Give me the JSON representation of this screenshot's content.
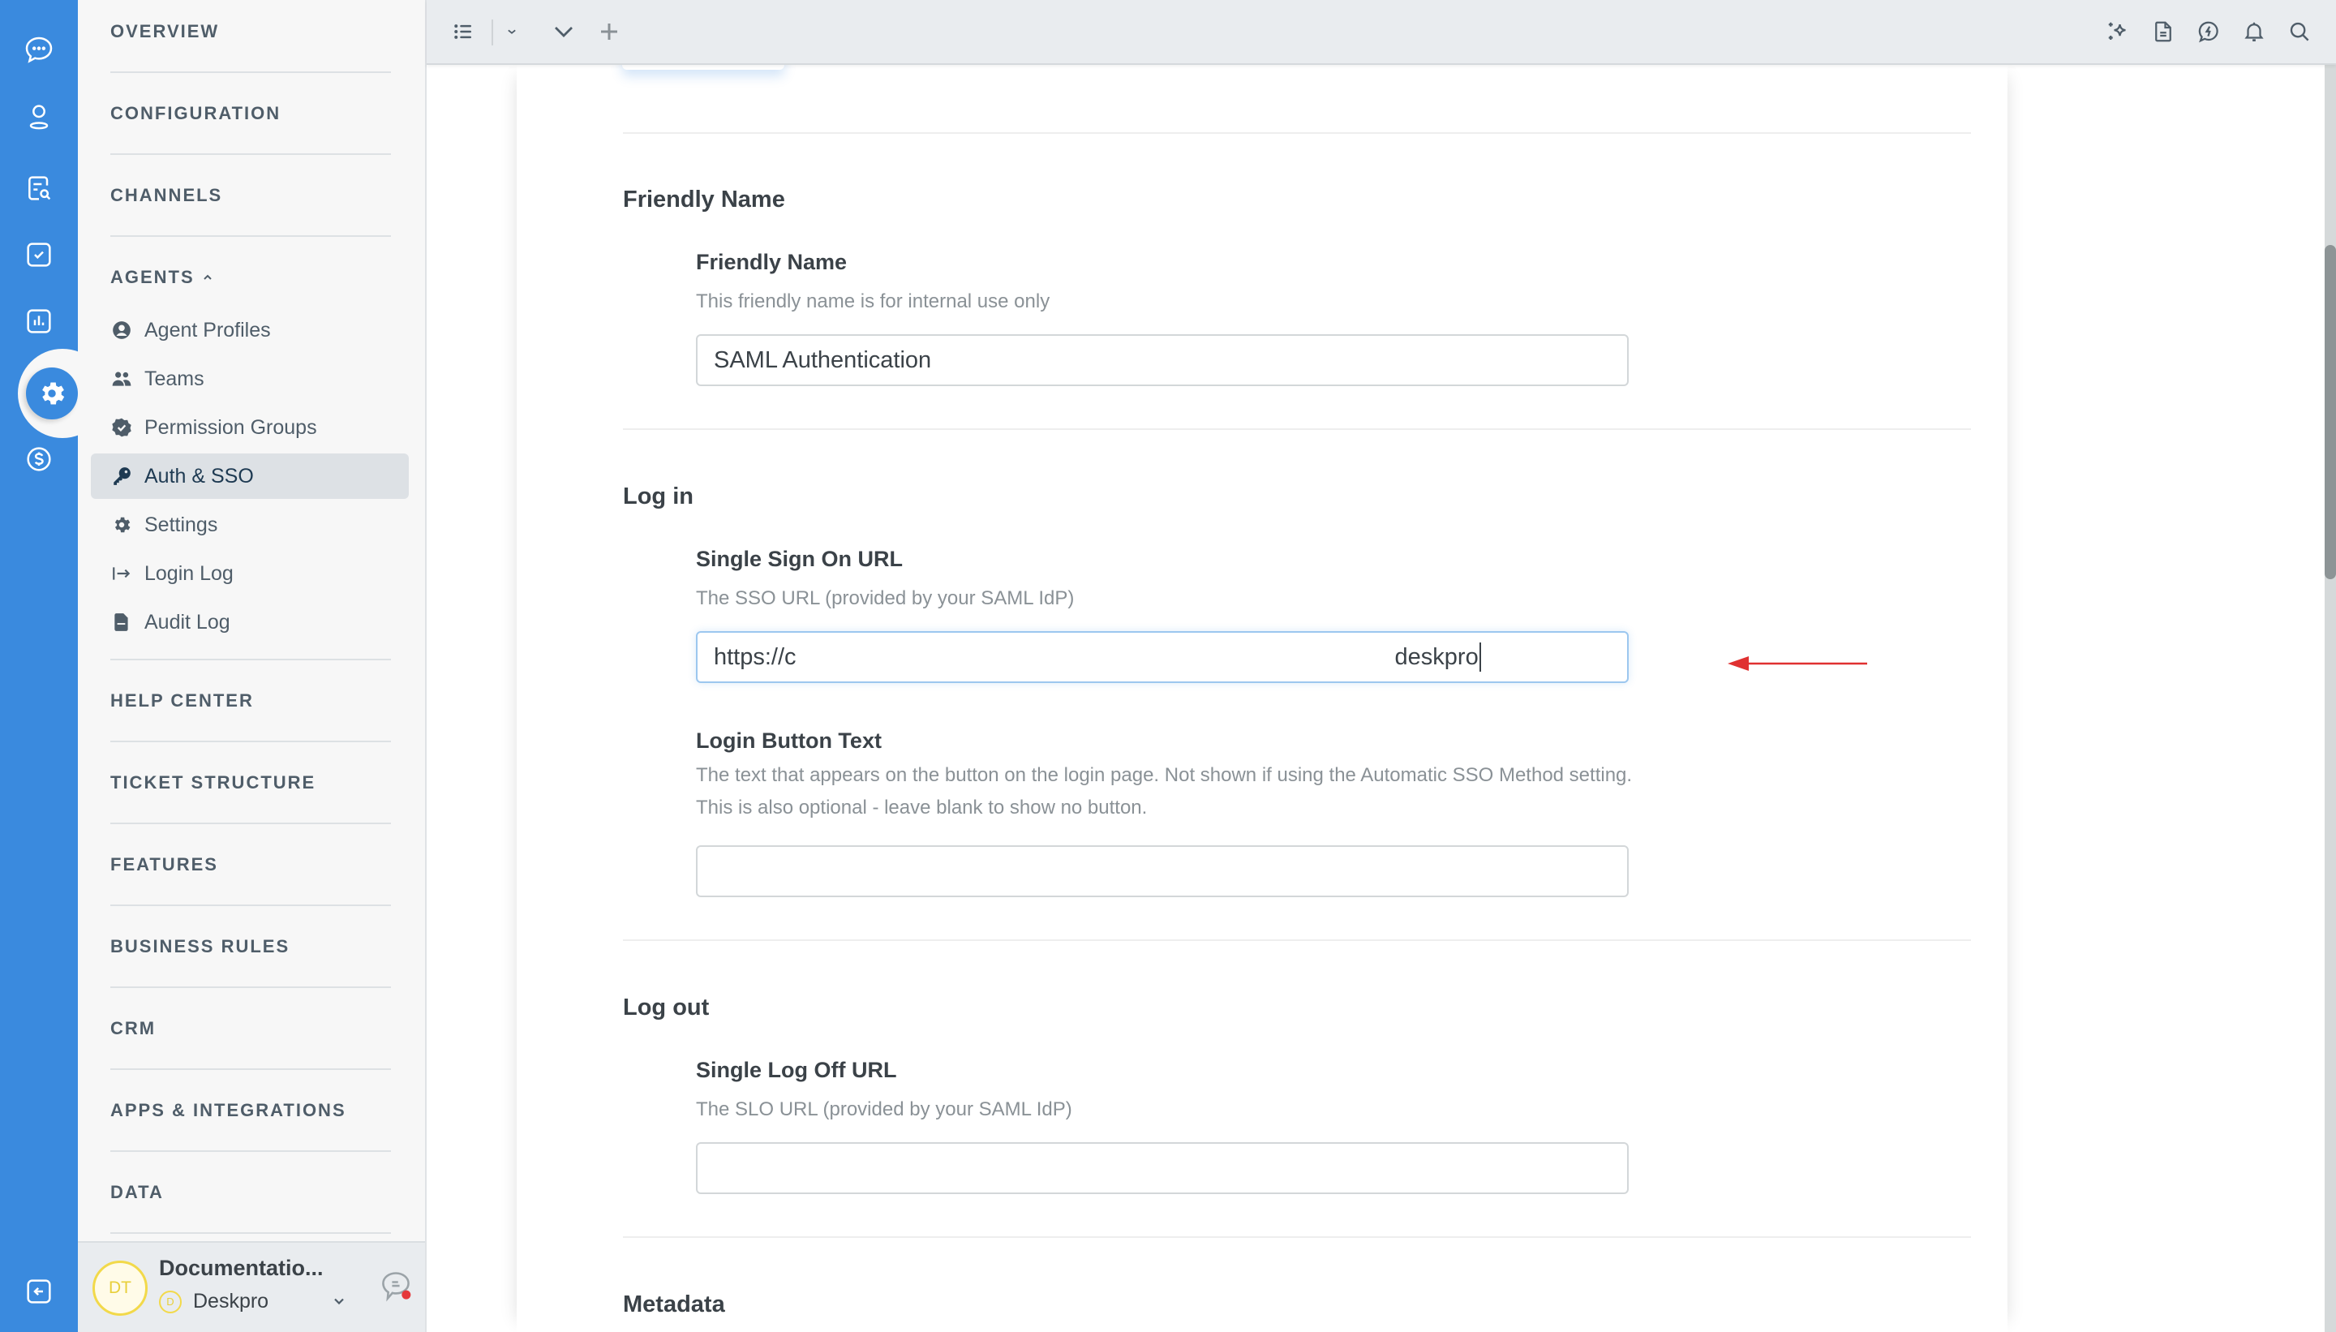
{
  "rail": {
    "icons": [
      "chat-icon",
      "user-icon",
      "search-document-icon",
      "task-check-icon",
      "reports-chart-icon",
      "settings-gear-icon",
      "billing-dollar-icon",
      "back-arrow-icon"
    ],
    "active": "settings-gear-icon",
    "accent_color": "#3a8ade"
  },
  "nav": {
    "sections": [
      {
        "label": "OVERVIEW"
      },
      {
        "label": "CONFIGURATION"
      },
      {
        "label": "CHANNELS"
      },
      {
        "label": "AGENTS",
        "expanded": true,
        "items": [
          {
            "label": "Agent Profiles",
            "icon": "user-circle-icon"
          },
          {
            "label": "Teams",
            "icon": "users-icon"
          },
          {
            "label": "Permission Groups",
            "icon": "badge-check-icon"
          },
          {
            "label": "Auth & SSO",
            "icon": "key-icon",
            "selected": true
          },
          {
            "label": "Settings",
            "icon": "gear-icon"
          },
          {
            "label": "Login Log",
            "icon": "login-arrow-icon"
          },
          {
            "label": "Audit Log",
            "icon": "file-icon"
          }
        ]
      },
      {
        "label": "HELP CENTER"
      },
      {
        "label": "TICKET STRUCTURE"
      },
      {
        "label": "FEATURES"
      },
      {
        "label": "BUSINESS RULES"
      },
      {
        "label": "CRM"
      },
      {
        "label": "APPS & INTEGRATIONS"
      },
      {
        "label": "DATA"
      }
    ],
    "footer": {
      "avatar_initials": "DT",
      "name": "Documentatio...",
      "org_badge": "D",
      "org": "Deskpro"
    }
  },
  "topbar": {
    "left_icons": [
      "list-icon",
      "chevron-down-small-icon",
      "chevron-down-icon",
      "plus-icon"
    ],
    "right_icons": [
      "sparkle-icon",
      "document-icon",
      "lightning-chat-icon",
      "bell-icon",
      "search-icon"
    ]
  },
  "form": {
    "sections": [
      {
        "title": "Friendly Name",
        "fields": [
          {
            "label": "Friendly Name",
            "description": "This friendly name is for internal use only",
            "value": "SAML Authentication"
          }
        ]
      },
      {
        "title": "Log in",
        "fields": [
          {
            "label": "Single Sign On URL",
            "description": "The SSO URL (provided by your SAML IdP)",
            "value_prefix": "https://c",
            "value_suffix": "deskpro",
            "focused": true
          },
          {
            "label": "Login Button Text",
            "description": "The text that appears on the button on the login page. Not shown if using the Automatic SSO Method setting. This is also optional - leave blank to show no button.",
            "value": ""
          }
        ]
      },
      {
        "title": "Log out",
        "fields": [
          {
            "label": "Single Log Off URL",
            "description": "The SLO URL (provided by your SAML IdP)",
            "value": ""
          }
        ]
      },
      {
        "title": "Metadata",
        "fields": []
      }
    ],
    "annotation_arrow_color": "#e03131"
  }
}
